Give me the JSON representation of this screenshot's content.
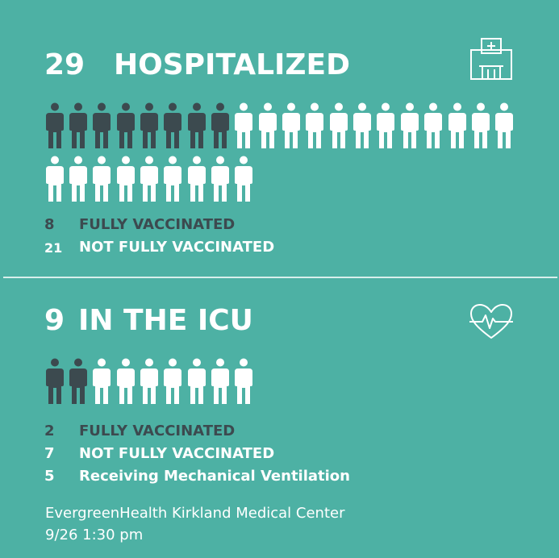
{
  "hospitalized": {
    "count": "29",
    "title": "HOSPITALIZED",
    "icon": "hospital-icon",
    "stats": [
      {
        "num": "8",
        "label": "FULLY VACCINATED",
        "tone": "dark"
      },
      {
        "num": "21",
        "label": "NOT FULLY VACCINATED",
        "tone": "white"
      }
    ],
    "people": {
      "total": 29,
      "fully_vaccinated": 8
    }
  },
  "icu": {
    "count": "9",
    "title": "IN THE ICU",
    "icon": "heart-pulse-icon",
    "stats": [
      {
        "num": "2",
        "label": "FULLY VACCINATED",
        "tone": "dark"
      },
      {
        "num": "7",
        "label": "NOT FULLY VACCINATED",
        "tone": "white"
      },
      {
        "num": "5",
        "label": "Receiving Mechanical Ventilation",
        "tone": "white"
      }
    ],
    "people": {
      "total": 9,
      "fully_vaccinated": 2
    }
  },
  "footer": {
    "source": "EvergreenHealth Kirkland Medical Center",
    "timestamp": "9/26 1:30 pm"
  },
  "colors": {
    "background": "#4db1a4",
    "vaccinated": "#3c4a4f",
    "not_vaccinated": "#ffffff"
  }
}
